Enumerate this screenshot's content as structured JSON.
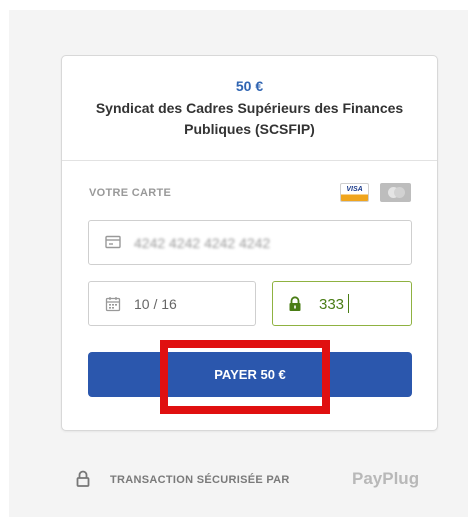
{
  "payment": {
    "amount": "50 €",
    "merchant": "Syndicat des Cadres Supérieurs des Finances Publiques (SCSFIP)"
  },
  "card_section": {
    "label": "VOTRE CARTE",
    "logos": {
      "visa": "VISA",
      "mastercard_icon": "mastercard-icon"
    }
  },
  "fields": {
    "card_number": "4242 4242 4242 4242",
    "expiry": "10 / 16",
    "cvc": "333"
  },
  "button": {
    "pay_label": "PAYER 50 €"
  },
  "footer": {
    "secure_text": "TRANSACTION SÉCURISÉE PAR",
    "brand": "PayPlug"
  },
  "colors": {
    "accent": "#2b57ad",
    "amount": "#2f64b2",
    "cvc_valid": "#8fb241",
    "highlight": "#e01010"
  }
}
